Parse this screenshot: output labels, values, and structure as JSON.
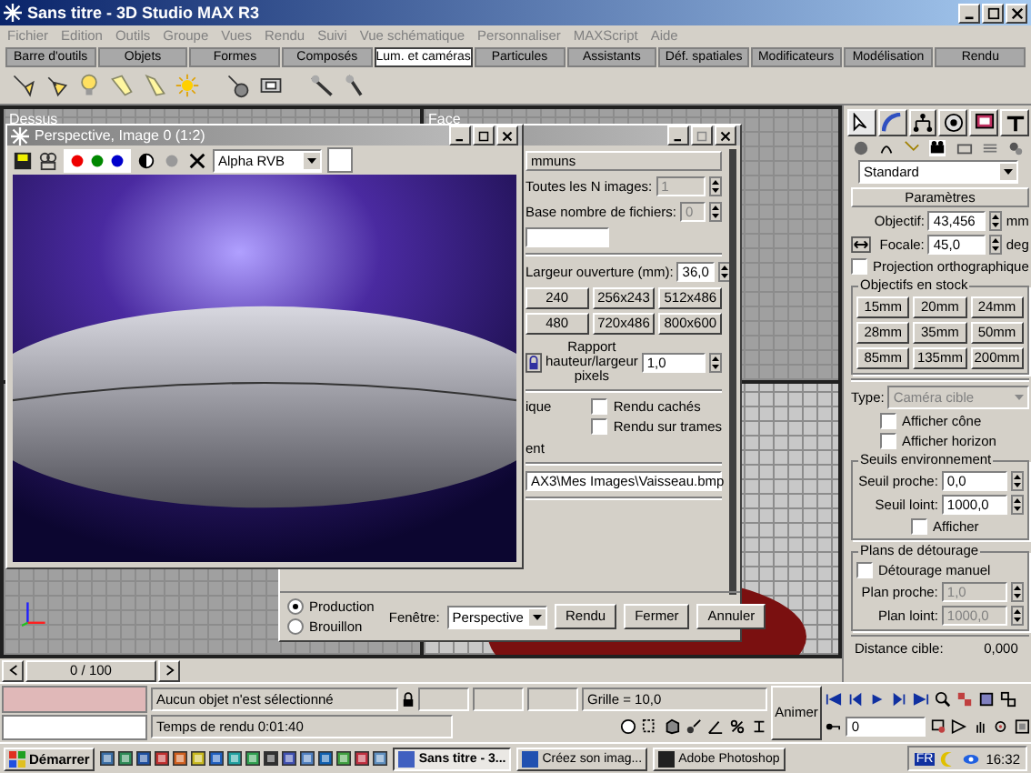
{
  "window": {
    "title": "Sans titre - 3D Studio MAX R3"
  },
  "menu": [
    "Fichier",
    "Edition",
    "Outils",
    "Groupe",
    "Vues",
    "Rendu",
    "Suivi",
    "Vue schématique",
    "Personnaliser",
    "MAXScript",
    "Aide"
  ],
  "tabs": [
    {
      "label": "Barre d'outils",
      "selected": false
    },
    {
      "label": "Objets",
      "selected": false
    },
    {
      "label": "Formes",
      "selected": false
    },
    {
      "label": "Composés",
      "selected": false
    },
    {
      "label": "Lum. et caméras",
      "selected": true
    },
    {
      "label": "Particules",
      "selected": false
    },
    {
      "label": "Assistants",
      "selected": false
    },
    {
      "label": "Déf. spatiales",
      "selected": false
    },
    {
      "label": "Modificateurs",
      "selected": false
    },
    {
      "label": "Modélisation",
      "selected": false
    },
    {
      "label": "Rendu",
      "selected": false
    }
  ],
  "viewports": {
    "top_left": "Dessus",
    "top_right": "Face"
  },
  "image_window": {
    "title": "Perspective, Image 0 (1:2)",
    "channel": "Alpha RVB"
  },
  "render_dialog": {
    "rollout": "mmuns",
    "every_n_label": "Toutes les N images:",
    "every_n_value": "1",
    "file_base_label": "Base nombre de fichiers:",
    "file_base_value": "0",
    "aperture_label": "Largeur ouverture (mm):",
    "aperture_value": "36,0",
    "sizes": [
      "240",
      "256x243",
      "512x486",
      "480",
      "720x486",
      "800x600"
    ],
    "aspect_label": "Rapport hauteur/largeur pixels",
    "aspect_value": "1,0",
    "partial_1": "ique",
    "options": [
      {
        "label": "Rendu cachés",
        "checked": false
      },
      {
        "label": "Rendu sur trames",
        "checked": false
      }
    ],
    "partial_2": "ent",
    "output_path": "AX3\\Mes Images\\Vaisseau.bmp",
    "modes": [
      {
        "label": "Production",
        "selected": true
      },
      {
        "label": "Brouillon",
        "selected": false
      }
    ],
    "viewport_label": "Fenêtre:",
    "viewport_value": "Perspective",
    "buttons": [
      "Rendu",
      "Fermer",
      "Annuler"
    ]
  },
  "command_panel": {
    "dropdown": "Standard",
    "rollout": "Paramètres",
    "lens_label": "Objectif:",
    "lens_value": "43,456",
    "lens_unit": "mm",
    "fov_label": "Focale:",
    "fov_value": "45,0",
    "fov_unit": "deg",
    "ortho": {
      "label": "Projection orthographique",
      "checked": false
    },
    "stock_title": "Objectifs en stock",
    "stock": [
      "15mm",
      "20mm",
      "24mm",
      "28mm",
      "35mm",
      "50mm",
      "85mm",
      "135mm",
      "200mm"
    ],
    "type_label": "Type:",
    "type_value": "Caméra cible",
    "type_disabled": true,
    "cone": {
      "label": "Afficher cône",
      "checked": false
    },
    "horizon": {
      "label": "Afficher horizon",
      "checked": false
    },
    "env_title": "Seuils environnement",
    "near_label": "Seuil proche:",
    "near_value": "0,0",
    "far_label": "Seuil loint:",
    "far_value": "1000,0",
    "env_show": {
      "label": "Afficher",
      "checked": false
    },
    "clip_title": "Plans de détourage",
    "manual": {
      "label": "Détourage manuel",
      "checked": false
    },
    "clip_near_label": "Plan proche:",
    "clip_near_value": "1,0",
    "clip_far_label": "Plan loint:",
    "clip_far_value": "1000,0",
    "target_label": "Distance cible:",
    "target_value": "0,000"
  },
  "timeline": {
    "label": "0 / 100",
    "level": 0
  },
  "status": {
    "message": "Aucun objet n'est sélectionné",
    "render_time": "Temps de rendu  0:01:40",
    "grid": "Grille = 10,0",
    "animate": "Animer",
    "frame": "0"
  },
  "taskbar": {
    "start": "Démarrer",
    "tasks": [
      {
        "label": "Sans titre - 3...",
        "selected": true
      },
      {
        "label": "Créez son imag...",
        "selected": false
      },
      {
        "label": "Adobe Photoshop",
        "selected": false
      }
    ],
    "language": "FR",
    "clock": "16:32"
  }
}
